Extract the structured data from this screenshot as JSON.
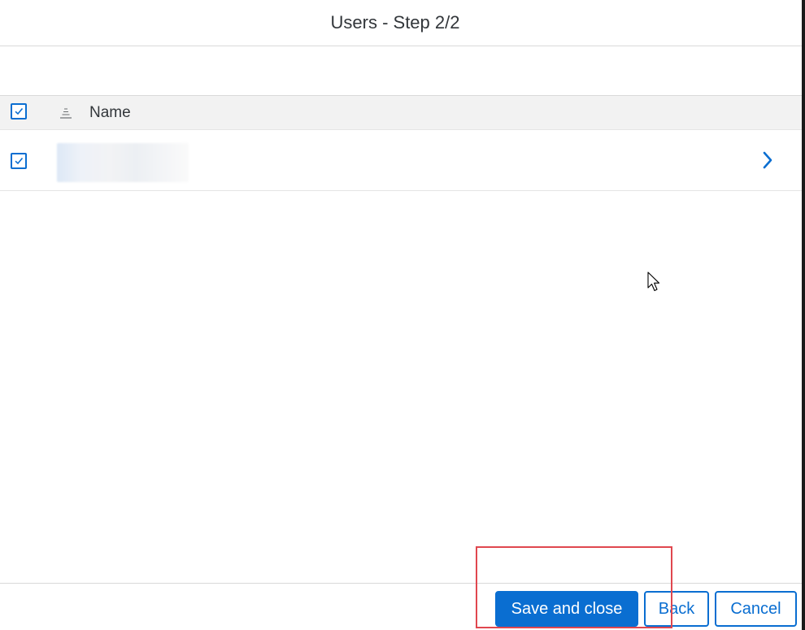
{
  "dialog": {
    "title": "Users - Step 2/2"
  },
  "table": {
    "columns": [
      {
        "label": "Name",
        "sort_icon": "sort-icon"
      }
    ],
    "select_all_checked": true,
    "rows": [
      {
        "name_redacted": true,
        "checked": true,
        "nav_icon": "chevron-right-icon"
      }
    ]
  },
  "footer": {
    "save_label": "Save and close",
    "back_label": "Back",
    "cancel_label": "Cancel"
  },
  "colors": {
    "accent": "#0a6ed1",
    "highlight": "#e0474f",
    "header_bg": "#f2f2f2"
  }
}
